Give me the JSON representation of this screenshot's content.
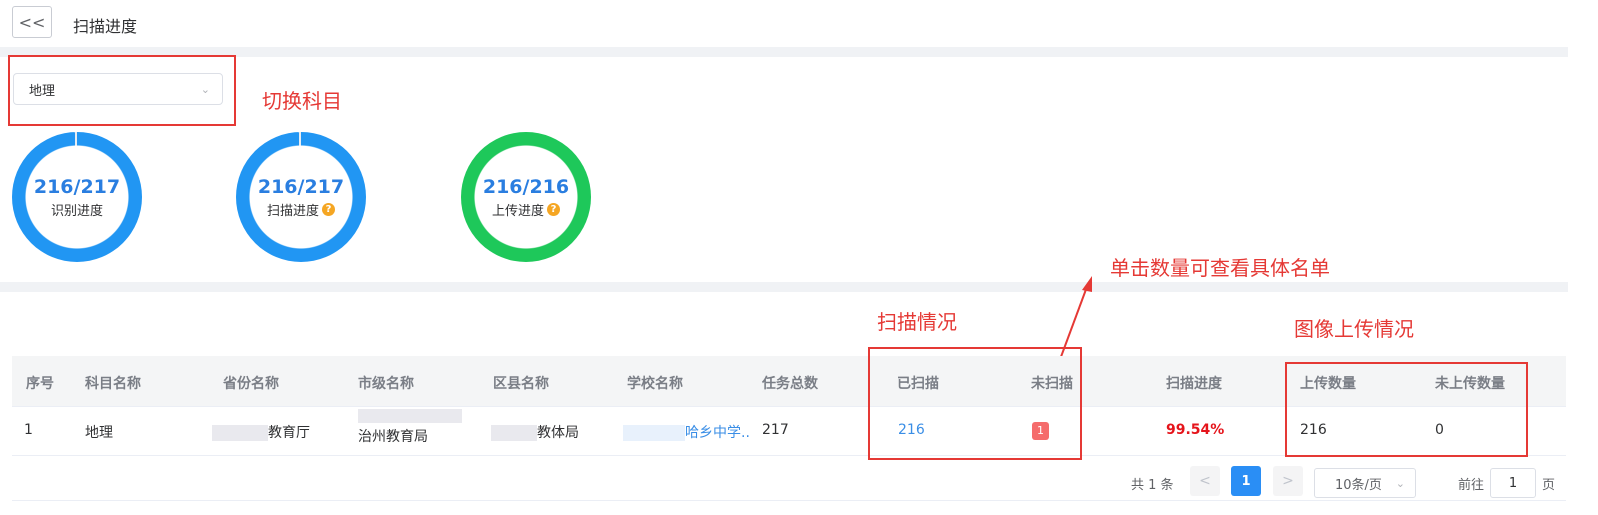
{
  "header": {
    "back_label": "<<",
    "title": "扫描进度"
  },
  "subject_select": {
    "value": "地理"
  },
  "annotations": {
    "switch_subject": "切换科目",
    "click_hint": "单击数量可查看具体名单",
    "scan_status": "扫描情况",
    "upload_status": "图像上传情况"
  },
  "progress": [
    {
      "value": "216/217",
      "label": "识别进度",
      "fraction": 0.9954,
      "help": false
    },
    {
      "value": "216/217",
      "label": "扫描进度",
      "fraction": 0.9954,
      "help": true
    },
    {
      "value": "216/216",
      "label": "上传进度",
      "fraction": 1.0,
      "help": true
    }
  ],
  "colors": {
    "ring_blue": "#2196f3",
    "ring_green": "#1ec85a",
    "accent": "#2a8ef5",
    "danger": "#e53935"
  },
  "table": {
    "headers": [
      "序号",
      "科目名称",
      "省份名称",
      "市级名称",
      "区县名称",
      "学校名称",
      "任务总数",
      "已扫描",
      "未扫描",
      "扫描进度",
      "上传数量",
      "未上传数量"
    ],
    "rows": [
      {
        "index": "1",
        "subject": "地理",
        "province": "教育厅",
        "city": "治州教育局",
        "district": "教体局",
        "school": "哈乡中学..",
        "total": "217",
        "scanned": "216",
        "unscanned": "1",
        "progress": "99.54%",
        "uploaded": "216",
        "not_uploaded": "0"
      }
    ]
  },
  "pagination": {
    "total_text": "共 1 条",
    "prev": "<",
    "current": "1",
    "next": ">",
    "page_size": "10条/页",
    "goto_label": "前往",
    "goto_value": "1",
    "page_suffix": "页"
  }
}
